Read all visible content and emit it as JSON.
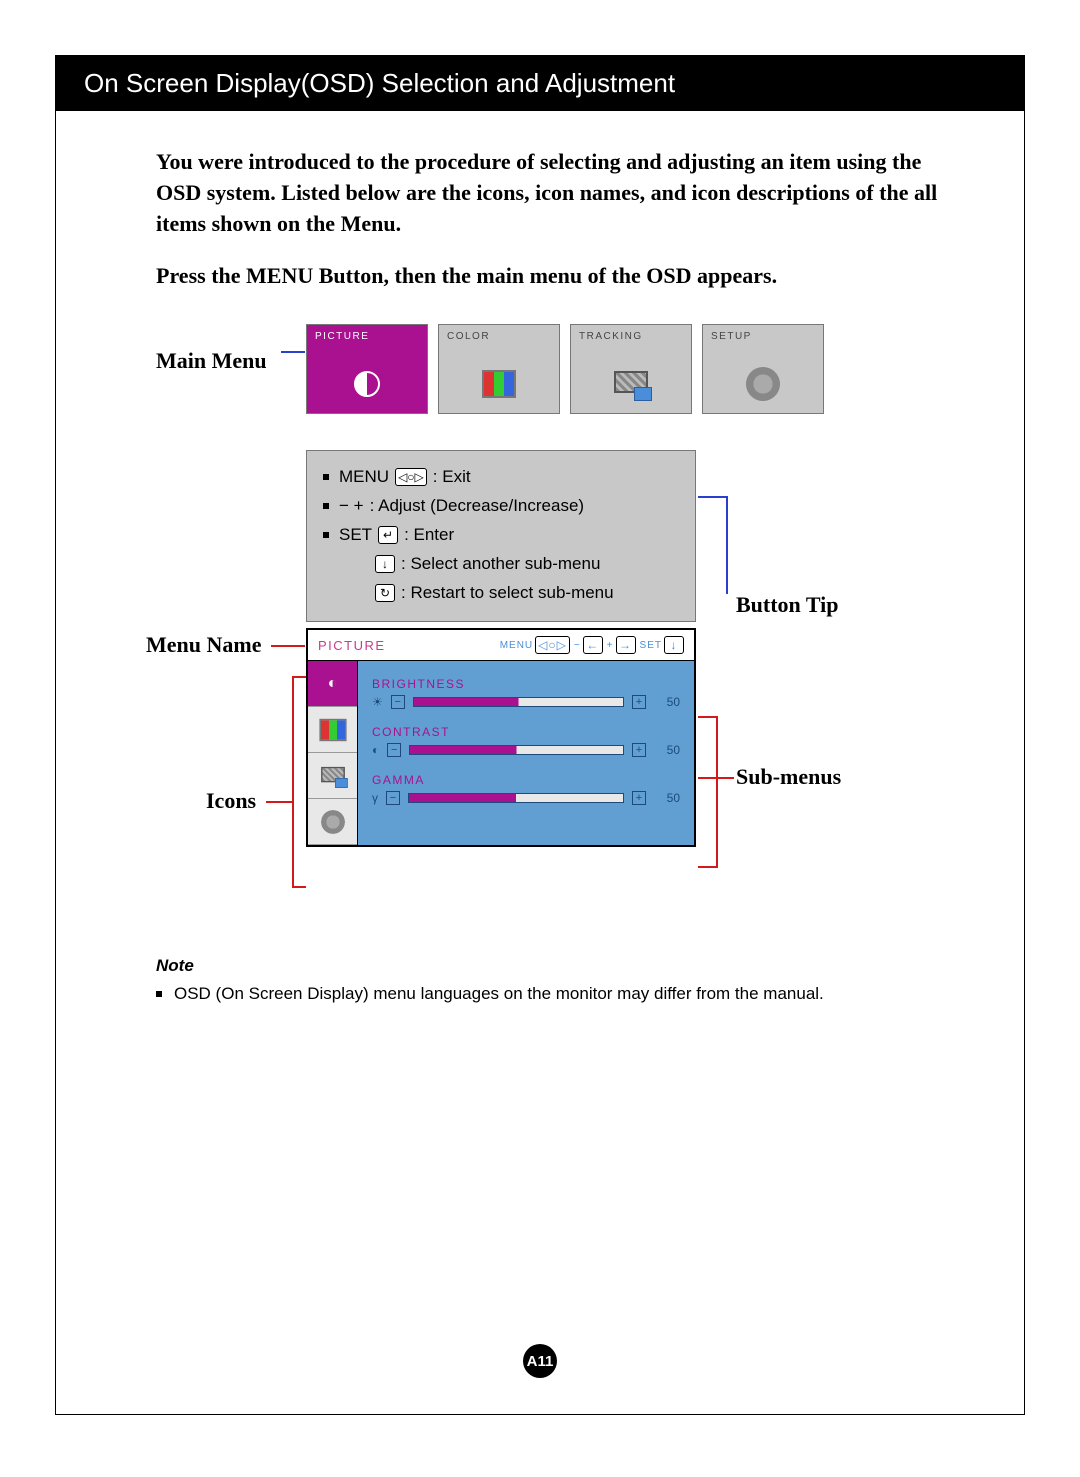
{
  "header": "On Screen Display(OSD) Selection and Adjustment",
  "intro": [
    "You were introduced to the procedure of selecting and adjusting an item using the OSD system.  Listed below are the icons, icon names, and icon descriptions of the all items shown on the Menu.",
    "Press the MENU Button, then the main menu of the OSD appears."
  ],
  "labels": {
    "mainmenu": "Main Menu",
    "buttontip": "Button Tip",
    "menuname": "Menu Name",
    "icons": "Icons",
    "submenus": "Sub-menus"
  },
  "tiles": [
    {
      "name": "PICTURE",
      "active": true
    },
    {
      "name": "COLOR",
      "active": false
    },
    {
      "name": "TRACKING",
      "active": false
    },
    {
      "name": "SETUP",
      "active": false
    }
  ],
  "buttontips": [
    {
      "prefix": "MENU",
      "glyph": "◁○▷",
      "desc": ": Exit"
    },
    {
      "prefix": "−  +",
      "glyph": "",
      "desc": ": Adjust (Decrease/Increase)"
    },
    {
      "prefix": "SET",
      "glyph": "↵",
      "desc": ": Enter"
    },
    {
      "prefix": "",
      "glyph": "↓",
      "desc": ": Select another sub-menu"
    },
    {
      "prefix": "",
      "glyph": "↻",
      "desc": ": Restart to select sub-menu"
    }
  ],
  "osd": {
    "name": "PICTURE",
    "topbtns": [
      {
        "t": "MENU",
        "g": "◁○▷"
      },
      {
        "t": "−",
        "g": "←"
      },
      {
        "t": "+",
        "g": "→"
      },
      {
        "t": "SET",
        "g": "↓"
      }
    ],
    "submenus": [
      {
        "label": "BRIGHTNESS",
        "icon": "☀",
        "value": 50
      },
      {
        "label": "CONTRAST",
        "icon": "◐",
        "value": 50
      },
      {
        "label": "GAMMA",
        "icon": "γ",
        "value": 50
      }
    ]
  },
  "note": {
    "heading": "Note",
    "text": "OSD (On Screen Display) menu languages on the monitor may differ from the manual."
  },
  "pagenum": "A11"
}
